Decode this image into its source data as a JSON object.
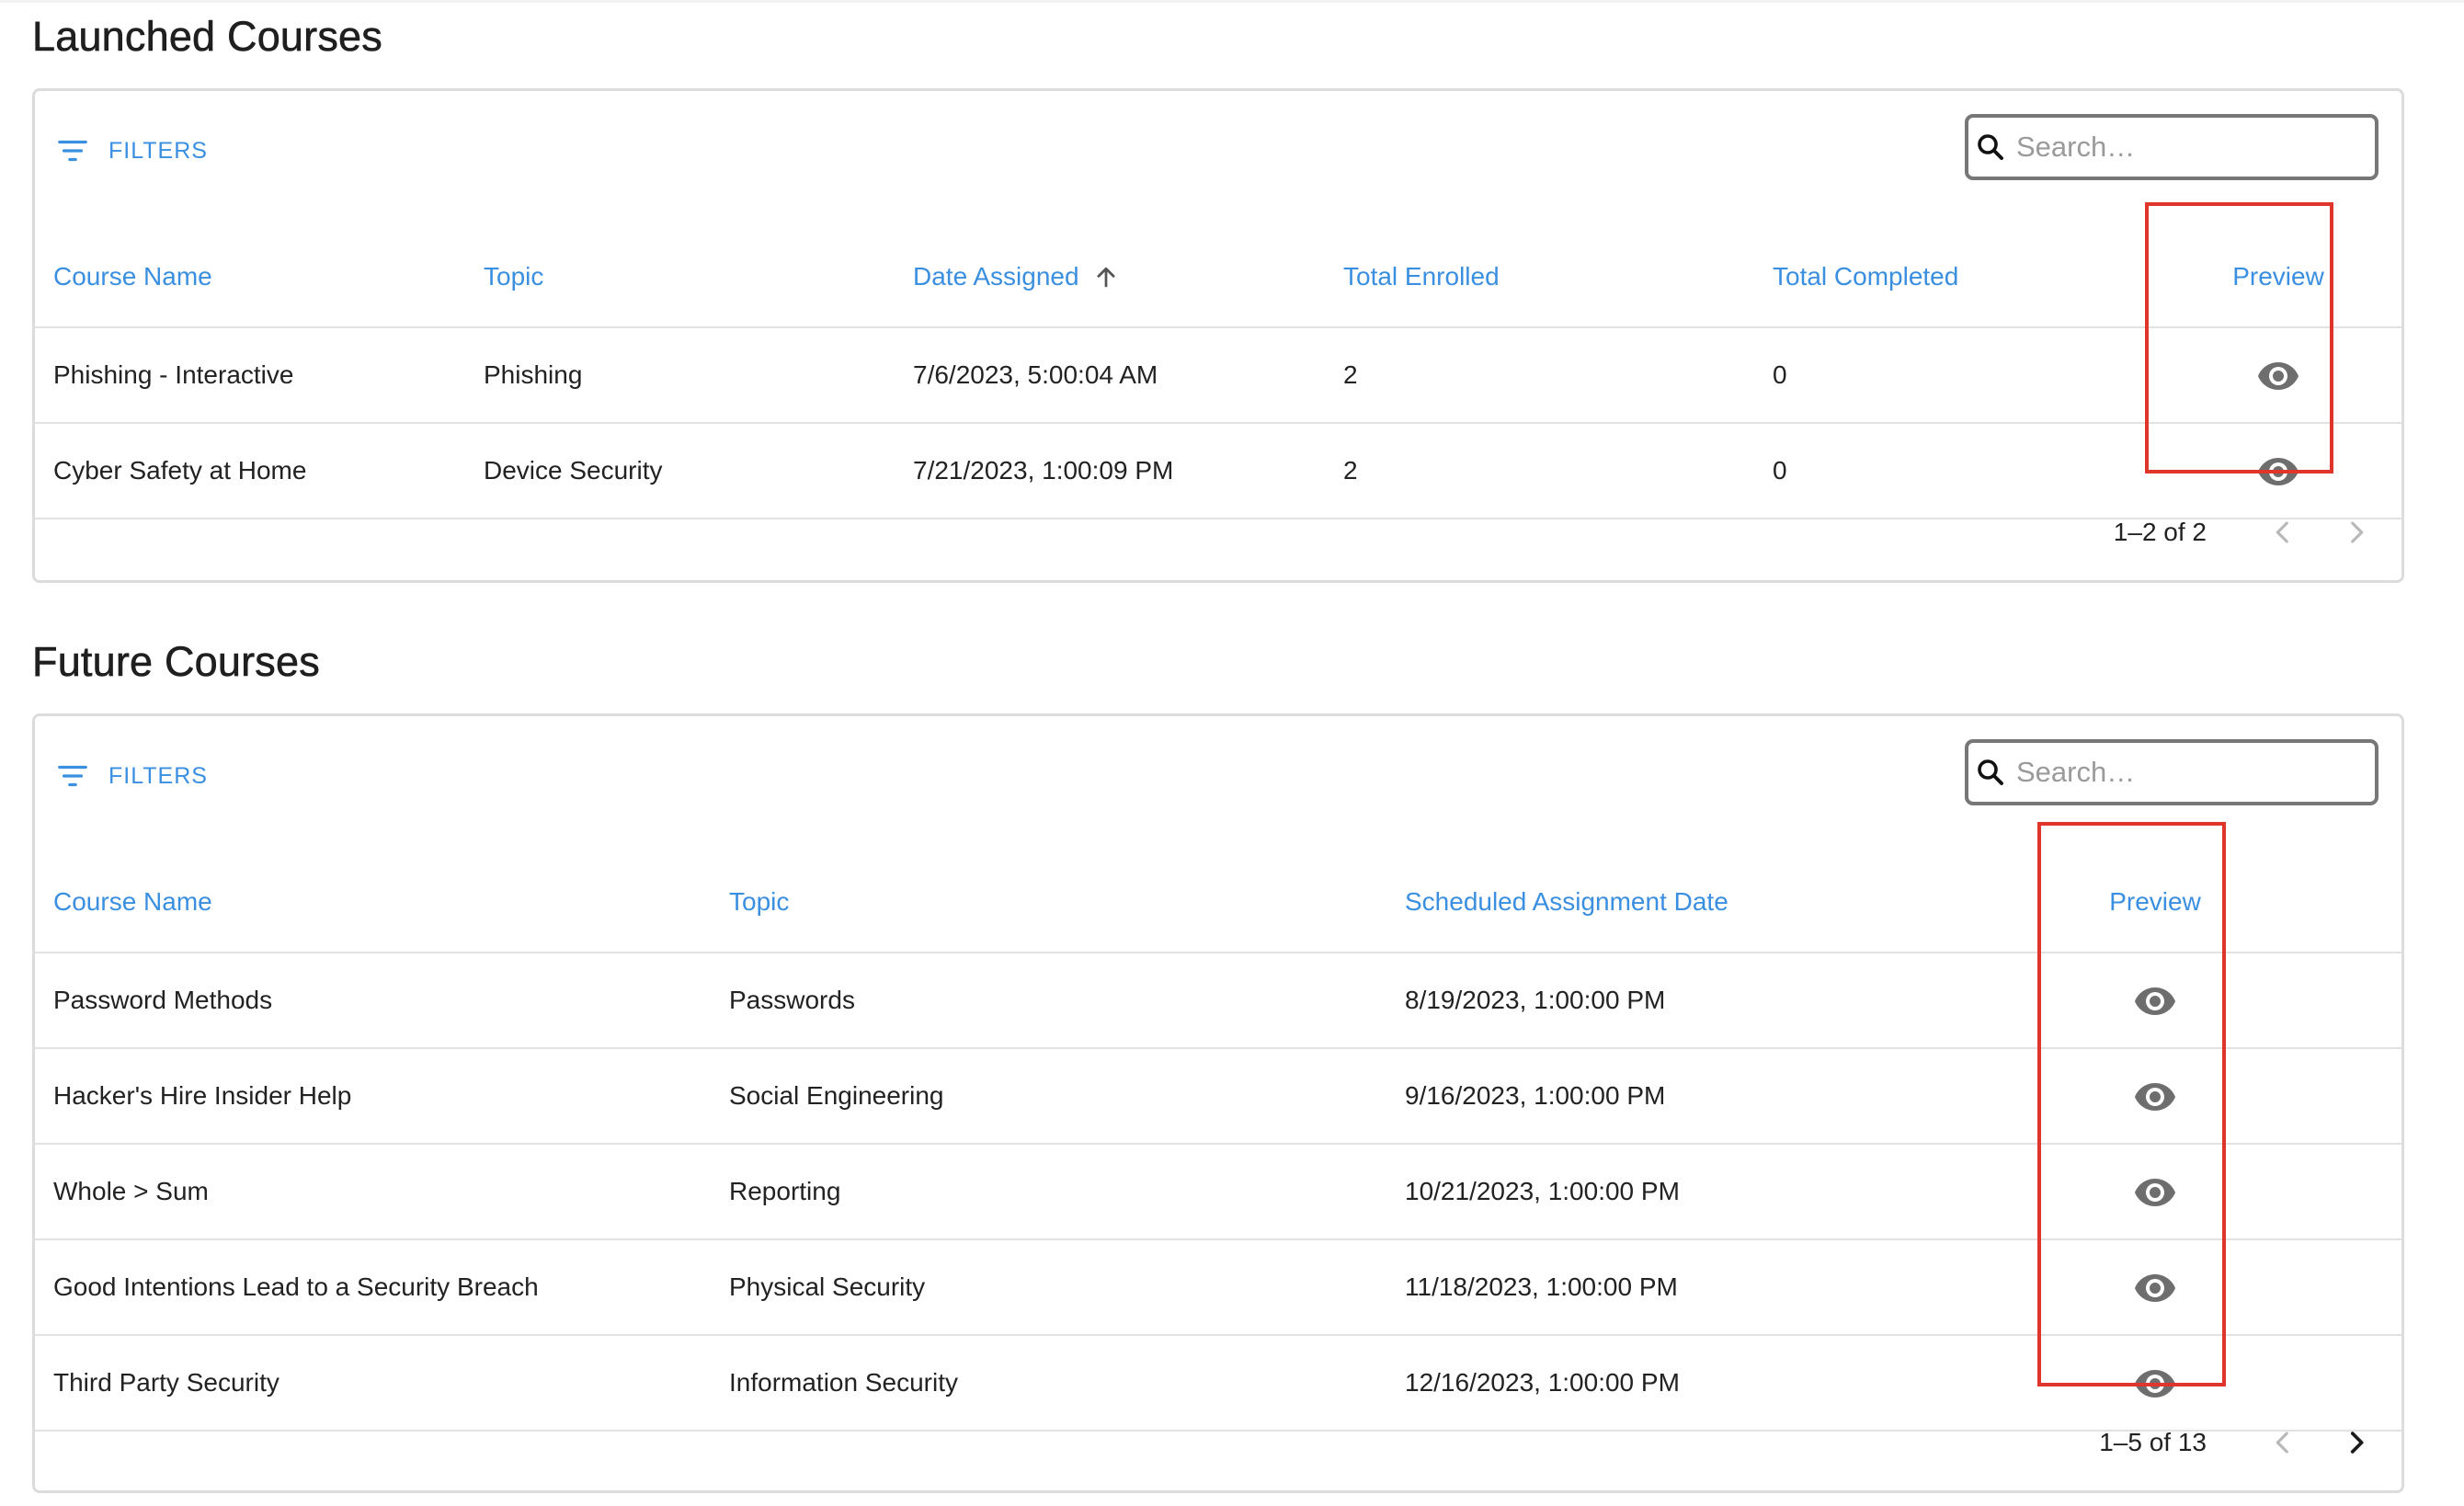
{
  "colors": {
    "accent": "#3a8fe0",
    "highlight": "#e0352b",
    "icon": "#6e6e6e"
  },
  "launched": {
    "title": "Launched Courses",
    "filters_label": "FILTERS",
    "search_placeholder": "Search…",
    "columns": {
      "course_name": "Course Name",
      "topic": "Topic",
      "date_assigned": "Date Assigned",
      "total_enrolled": "Total Enrolled",
      "total_completed": "Total Completed",
      "preview": "Preview"
    },
    "sort_icon": "arrow-up-icon",
    "rows": [
      {
        "course_name": "Phishing - Interactive",
        "topic": "Phishing",
        "date_assigned": "7/6/2023, 5:00:04 AM",
        "total_enrolled": "2",
        "total_completed": "0",
        "preview_icon": "eye-icon"
      },
      {
        "course_name": "Cyber Safety at Home",
        "topic": "Device Security",
        "date_assigned": "7/21/2023, 1:00:09 PM",
        "total_enrolled": "2",
        "total_completed": "0",
        "preview_icon": "eye-icon"
      }
    ],
    "pagination": {
      "range": "1–2 of 2",
      "prev_icon": "chevron-left-icon",
      "next_icon": "chevron-right-icon"
    }
  },
  "future": {
    "title": "Future Courses",
    "filters_label": "FILTERS",
    "search_placeholder": "Search…",
    "columns": {
      "course_name": "Course Name",
      "topic": "Topic",
      "scheduled_date": "Scheduled Assignment Date",
      "preview": "Preview"
    },
    "rows": [
      {
        "course_name": "Password Methods",
        "topic": "Passwords",
        "scheduled_date": "8/19/2023, 1:00:00 PM",
        "preview_icon": "eye-icon"
      },
      {
        "course_name": "Hacker's Hire Insider Help",
        "topic": "Social Engineering",
        "scheduled_date": "9/16/2023, 1:00:00 PM",
        "preview_icon": "eye-icon"
      },
      {
        "course_name": "Whole > Sum",
        "topic": "Reporting",
        "scheduled_date": "10/21/2023, 1:00:00 PM",
        "preview_icon": "eye-icon"
      },
      {
        "course_name": "Good Intentions Lead to a Security Breach",
        "topic": "Physical Security",
        "scheduled_date": "11/18/2023, 1:00:00 PM",
        "preview_icon": "eye-icon"
      },
      {
        "course_name": "Third Party Security",
        "topic": "Information Security",
        "scheduled_date": "12/16/2023, 1:00:00 PM",
        "preview_icon": "eye-icon"
      }
    ],
    "pagination": {
      "range": "1–5 of 13",
      "prev_icon": "chevron-left-icon",
      "next_icon": "chevron-right-icon"
    }
  }
}
